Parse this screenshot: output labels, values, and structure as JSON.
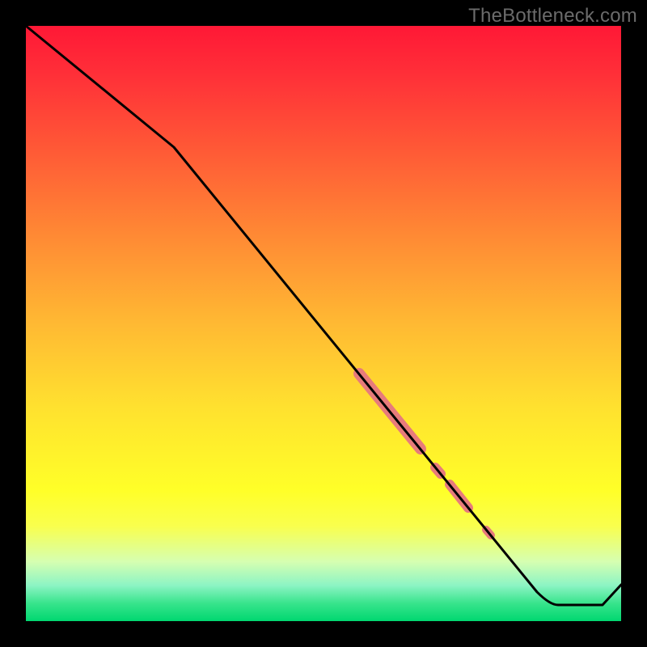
{
  "attribution": "TheBottleneck.com",
  "colors": {
    "line": "#000000",
    "accent": "#e77b7b",
    "background_black": "#000000"
  },
  "chart_data": {
    "type": "line",
    "title": "",
    "xlabel": "",
    "ylabel": "",
    "xlim": [
      0,
      100
    ],
    "ylim": [
      0,
      100
    ],
    "note": "Axes are unlabeled; values estimated from pixel positions within the 736x736 plot area. y_pct is measured from bottom (0) to top (100).",
    "series": [
      {
        "name": "curve",
        "points": [
          {
            "x_pct": 0.0,
            "y_pct": 100.0
          },
          {
            "x_pct": 24.9,
            "y_pct": 79.6
          },
          {
            "x_pct": 85.9,
            "y_pct": 4.9
          },
          {
            "x_pct": 89.4,
            "y_pct": 2.7
          },
          {
            "x_pct": 96.9,
            "y_pct": 2.7
          },
          {
            "x_pct": 100.0,
            "y_pct": 6.1
          }
        ]
      }
    ],
    "highlight_segments": [
      {
        "name": "main-accent",
        "x1_pct": 56.0,
        "y1_pct": 41.6,
        "x2_pct": 66.3,
        "y2_pct": 28.9,
        "width_rel": 1.0
      },
      {
        "name": "dot-1",
        "x1_pct": 68.8,
        "y1_pct": 25.8,
        "x2_pct": 69.7,
        "y2_pct": 24.7,
        "width_rel": 0.85
      },
      {
        "name": "short-accent",
        "x1_pct": 71.2,
        "y1_pct": 22.9,
        "x2_pct": 74.3,
        "y2_pct": 19.0,
        "width_rel": 0.85
      },
      {
        "name": "dot-2",
        "x1_pct": 77.3,
        "y1_pct": 15.4,
        "x2_pct": 78.1,
        "y2_pct": 14.4,
        "width_rel": 0.7
      }
    ]
  }
}
